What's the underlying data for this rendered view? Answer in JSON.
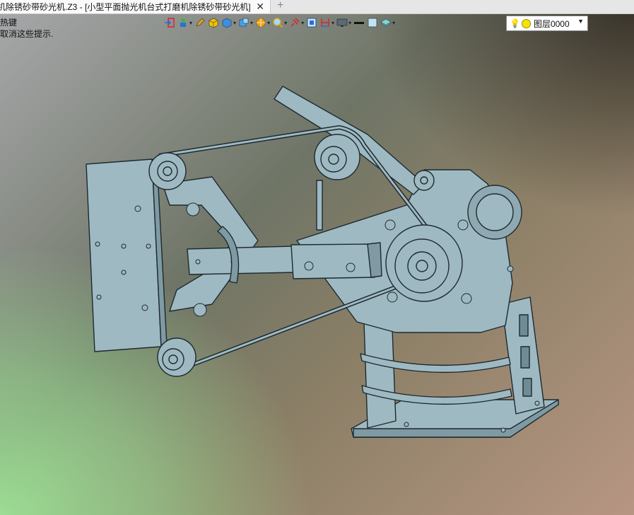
{
  "tab": {
    "title": "机除锈砂带砂光机.Z3 - [小型平面抛光机台式打磨机除锈砂带砂光机]",
    "close_icon": "close-icon",
    "add_icon": "plus-icon"
  },
  "hints": {
    "line1": "热键",
    "line2": "取消这些提示."
  },
  "toolbar": {
    "items": [
      {
        "name": "exit-icon"
      },
      {
        "name": "shading-icon"
      },
      {
        "name": "pencil-icon"
      },
      {
        "name": "box-icon"
      },
      {
        "name": "cube-icon"
      },
      {
        "name": "view-cube-icon"
      },
      {
        "name": "render-icon"
      },
      {
        "name": "zoom-icon"
      },
      {
        "name": "pin-icon"
      },
      {
        "name": "frame-icon"
      },
      {
        "name": "ruler-icon"
      },
      {
        "name": "monitor-icon"
      },
      {
        "name": "line-color-icon"
      },
      {
        "name": "face-color-icon"
      },
      {
        "name": "layer-icon"
      }
    ]
  },
  "layer": {
    "bulb_icon": "lightbulb-icon",
    "name": "图层0000"
  },
  "colors": {
    "part_fill": "#9fb9c2",
    "part_stroke": "#1c2a30"
  }
}
